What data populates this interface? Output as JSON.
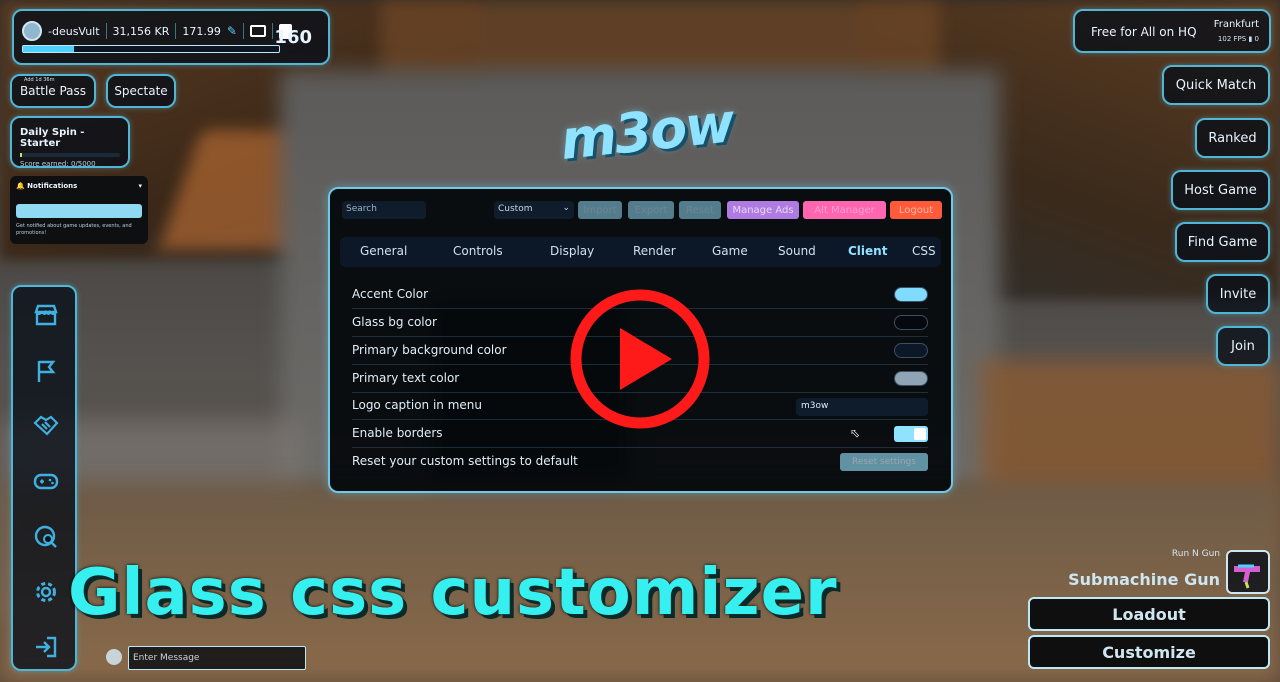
{
  "player": {
    "name": "-deusVult",
    "kr": "31,156 KR",
    "coins": "171.99",
    "xp_progress": 0.2,
    "level": "160"
  },
  "buttons": {
    "battle_pass_note": "Add 1d 36m",
    "battle_pass": "Battle Pass",
    "spectate": "Spectate"
  },
  "daily_spin": {
    "title": "Daily Spin - Starter",
    "score": "Score earned: 0/5000",
    "progress": 0
  },
  "notifications": {
    "title": "Notifications",
    "description": "Get notified about game updates, events, and promotions!"
  },
  "sidenav": {
    "items": [
      {
        "icon": "store-icon"
      },
      {
        "icon": "flag-icon"
      },
      {
        "icon": "handshake-icon"
      },
      {
        "icon": "gamepad-icon"
      },
      {
        "icon": "globe-search-icon"
      },
      {
        "icon": "gear-icon"
      },
      {
        "icon": "exit-icon"
      }
    ]
  },
  "chat": {
    "placeholder": "Enter Message"
  },
  "server": {
    "mode": "Free for All on HQ",
    "region": "Frankfurt",
    "fps": "102 FPS",
    "ping": "0"
  },
  "right_menu": {
    "quick_match": "Quick Match",
    "ranked": "Ranked",
    "host_game": "Host Game",
    "find_game": "Find Game",
    "invite": "Invite",
    "join": "Join"
  },
  "logo": "m3ow",
  "settings": {
    "search_placeholder": "Search",
    "preset": "Custom",
    "toolbar": {
      "import": "Import",
      "export": "Export",
      "reset": "Reset",
      "manage_ads": "Manage Ads",
      "alt_manager": "Alt Manager",
      "logout": "Logout"
    },
    "tabs": [
      "General",
      "Controls",
      "Display",
      "Render",
      "Game",
      "Sound",
      "Client",
      "CSS"
    ],
    "active_tab": "Client",
    "rows": {
      "accent_color": {
        "label": "Accent Color",
        "value": "#7fdcff"
      },
      "glass_bg": {
        "label": "Glass bg color",
        "value": "#05090f"
      },
      "primary_bg": {
        "label": "Primary background color",
        "value": "#0c1828"
      },
      "primary_text": {
        "label": "Primary text color",
        "value": "#8fa4b4"
      },
      "logo_caption": {
        "label": "Logo caption in menu",
        "value": "m3ow"
      },
      "enable_borders": {
        "label": "Enable borders",
        "value": true
      },
      "reset_custom": {
        "label": "Reset your custom settings to default",
        "button": "Reset settings"
      }
    }
  },
  "caption": "Glass css customizer",
  "weapon": {
    "class": "Run N Gun",
    "name": "Submachine Gun"
  },
  "bottom_buttons": {
    "loadout": "Loadout",
    "customize": "Customize"
  }
}
